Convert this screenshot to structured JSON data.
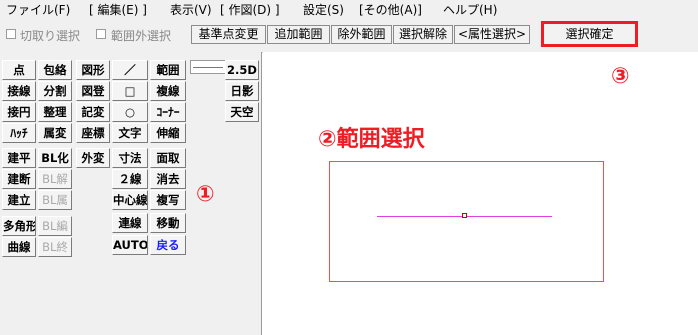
{
  "menubar": {
    "items": [
      "ファイル(F)",
      "[ 編集(E) ]",
      "表示(V)",
      "[ 作図(D) ]",
      "設定(S)",
      "[その他(A)]",
      "ヘルプ(H)"
    ]
  },
  "toolbar": {
    "checkboxes": [
      "切取り選択",
      "範囲外選択"
    ],
    "buttons": [
      "基準点変更",
      "追加範囲",
      "除外範囲",
      "選択解除",
      "<属性選択>"
    ],
    "confirm_label": "選択確定"
  },
  "left_panel": {
    "col1": [
      "点",
      "接線",
      "接円",
      "ﾊｯﾁ",
      "建平",
      "建断",
      "建立",
      "多角形",
      "曲線"
    ],
    "col2": [
      "包絡",
      "分割",
      "整理",
      "属変",
      "BL化",
      "BL解",
      "BL属",
      "BL編",
      "BL終"
    ],
    "col3": [
      "図形",
      "図登",
      "記変",
      "座標",
      "外変"
    ],
    "col4": [
      "／",
      "□",
      "○",
      "文字",
      "寸法",
      "２線",
      "中心線",
      "連線",
      "AUTO"
    ],
    "col5": [
      "範囲",
      "複線",
      "ｺｰﾅｰ",
      "伸縮",
      "面取",
      "消去",
      "複写",
      "移動",
      "戻る"
    ],
    "col6": [
      "2.5D",
      "日影",
      "天空"
    ]
  },
  "annotations": {
    "one": "①",
    "two": "②範囲選択",
    "three": "③"
  },
  "colors": {
    "annotation_red": "#ee1c24",
    "selection_line": "#e040e0",
    "disabled_text": "#a9a9a9",
    "back_button_text": "#1a1aff"
  }
}
